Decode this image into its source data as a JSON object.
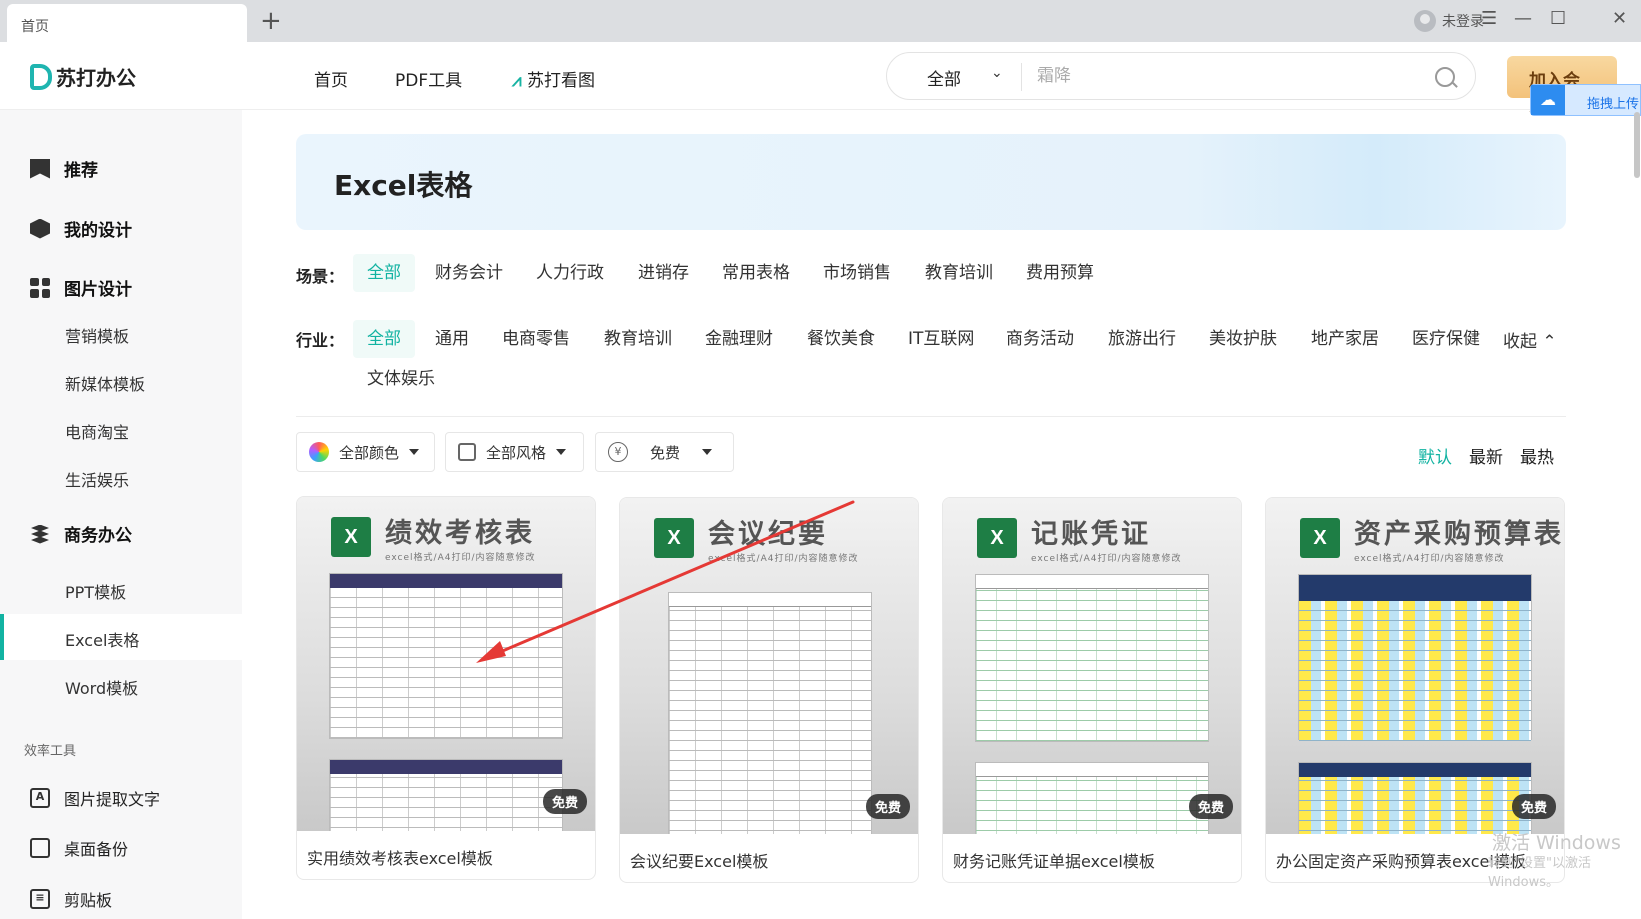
{
  "browser": {
    "tab_title": "首页",
    "new_tab": "+",
    "user_label": "未登录",
    "menu_glyph": "☰",
    "minimize_glyph": "—",
    "maximize_glyph": "☐",
    "close_glyph": "✕"
  },
  "header": {
    "brand": "苏打办公",
    "nav": [
      "首页",
      "PDF工具",
      "苏打看图"
    ],
    "search_scope": "全部",
    "search_placeholder": "霜降",
    "vip_button": "加入会员",
    "upload_float": "拖拽上传"
  },
  "sidebar": {
    "groups": [
      {
        "label": "推荐",
        "icon": "bookmark-icon"
      },
      {
        "label": "我的设计",
        "icon": "design-icon"
      },
      {
        "label": "图片设计",
        "icon": "grid-icon"
      }
    ],
    "image_design_items": [
      "营销模板",
      "新媒体模板",
      "电商淘宝",
      "生活娱乐"
    ],
    "business_group": "商务办公",
    "business_items": [
      "PPT模板",
      "Excel表格",
      "Word模板"
    ],
    "active_item": "Excel表格",
    "tools_section": "效率工具",
    "tools": [
      "图片提取文字",
      "桌面备份",
      "剪贴板"
    ]
  },
  "main": {
    "banner_title": "Excel表格",
    "scene_label": "场景：",
    "scenes": [
      "全部",
      "财务会计",
      "人力行政",
      "进销存",
      "常用表格",
      "市场销售",
      "教育培训",
      "费用预算"
    ],
    "industry_label": "行业：",
    "industries": [
      "全部",
      "通用",
      "电商零售",
      "教育培训",
      "金融理财",
      "餐饮美食",
      "IT互联网",
      "商务活动",
      "旅游出行",
      "美妆护肤",
      "地产家居",
      "医疗保健",
      "文体娱乐"
    ],
    "collapse_label": "收起",
    "filters": {
      "color": "全部颜色",
      "style": "全部风格",
      "price": "免费"
    },
    "sort": [
      "默认",
      "最新",
      "最热"
    ],
    "active_sort": "默认",
    "cards": [
      {
        "thumb_title": "绩效考核表",
        "thumb_sub": "excel格式/A4打印/内容随意修改",
        "badge": "免费",
        "title": "实用绩效考核表excel模板"
      },
      {
        "thumb_title": "会议纪要",
        "thumb_sub": "excel格式/A4打印/内容随意修改",
        "badge": "免费",
        "title": "会议纪要Excel模板"
      },
      {
        "thumb_title": "记账凭证",
        "thumb_sub": "excel格式/A4打印/内容随意修改",
        "badge": "免费",
        "title": "财务记账凭证单据excel模板"
      },
      {
        "thumb_title": "资产采购预算表",
        "thumb_sub": "excel格式/A4打印/内容随意修改",
        "badge": "免费",
        "title": "办公固定资产采购预算表excel模板"
      }
    ],
    "xl_letter": "X"
  },
  "os_watermark": {
    "line1": "激活 Windows",
    "line2": "转到\"设置\"以激活 Windows。"
  },
  "colors": {
    "accent": "#12b3a2",
    "vip": "#f3c27b",
    "annotation_arrow": "#e53935"
  }
}
